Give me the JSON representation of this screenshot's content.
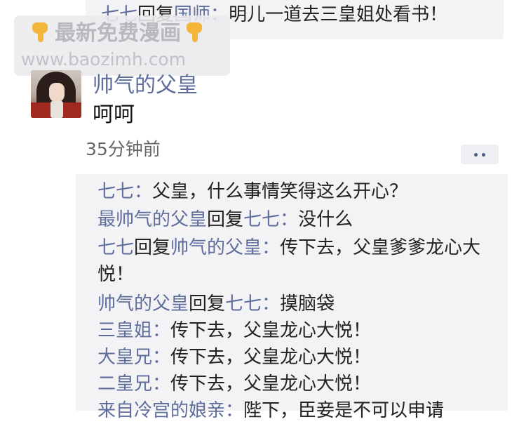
{
  "top_comment": {
    "author": "七七",
    "reply_word": "回复",
    "reply_to": "国师",
    "separator": "：",
    "text": "明儿一道去三皇姐处看书！"
  },
  "watermark": {
    "title": "最新免费漫画",
    "url": "www.baozimh.com",
    "hand_icon": "pointing-down-hand-icon"
  },
  "post": {
    "avatar_icon": "user-avatar-image",
    "username": "帅气的父皇",
    "text": "呵呵",
    "time": "35分钟前",
    "more_icon": "more-dots-icon"
  },
  "comments": [
    {
      "author": "七七",
      "separator": "：",
      "text": "父皇，什么事情笑得这么开心？"
    },
    {
      "author": "最帅气的父皇",
      "reply_word": "回复",
      "reply_to": "七七",
      "separator": "：",
      "text": "没什么"
    },
    {
      "author": "七七",
      "reply_word": "回复",
      "reply_to": "帅气的父皇",
      "separator": "：",
      "text": "传下去，父皇爹爹龙心大悦！"
    },
    {
      "author": "帅气的父皇",
      "reply_word": "回复",
      "reply_to": "七七",
      "separator": "：",
      "text": "摸脑袋"
    },
    {
      "author": "三皇姐",
      "separator": "：",
      "text": "传下去，父皇龙心大悦！"
    },
    {
      "author": "大皇兄",
      "separator": "：",
      "text": "传下去，父皇龙心大悦！"
    },
    {
      "author": "二皇兄",
      "separator": "：",
      "text": "传下去，父皇龙心大悦！"
    },
    {
      "author": "来自冷宫的娘亲",
      "separator": "：",
      "text": "陛下，臣妾是不可以申请"
    }
  ],
  "colors": {
    "nickname": "#5e6d9c",
    "text": "#222222",
    "comment_background": "#f3f3f5"
  }
}
